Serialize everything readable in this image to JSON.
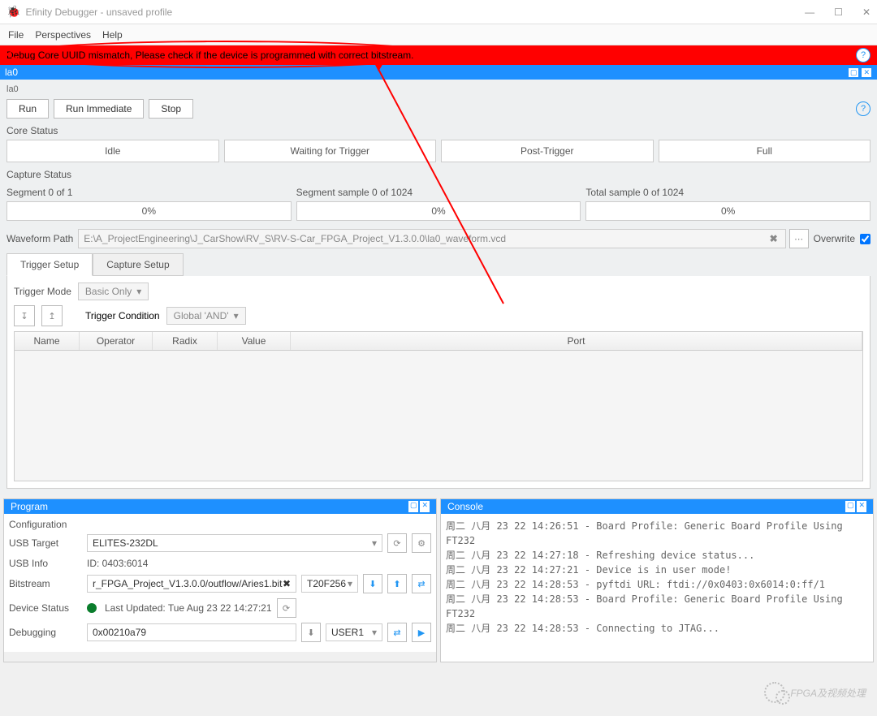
{
  "window": {
    "title": "Efinity Debugger - unsaved profile"
  },
  "menu": {
    "file": "File",
    "perspectives": "Perspectives",
    "help": "Help"
  },
  "error": {
    "message": "Debug Core UUID mismatch, Please check if the device is programmed with correct bitstream."
  },
  "la0": {
    "name": "la0",
    "label": "la0",
    "buttons": {
      "run": "Run",
      "run_immediate": "Run Immediate",
      "stop": "Stop"
    },
    "core_status": {
      "title": "Core Status",
      "idle": "Idle",
      "waiting": "Waiting for Trigger",
      "post": "Post-Trigger",
      "full": "Full"
    },
    "capture_status": {
      "title": "Capture Status",
      "segment": "Segment 0 of 1",
      "segment_sample": "Segment sample 0 of 1024",
      "total_sample": "Total sample 0 of 1024",
      "p1": "0%",
      "p2": "0%",
      "p3": "0%"
    },
    "waveform": {
      "label": "Waveform Path",
      "path": "E:\\A_ProjectEngineering\\J_CarShow\\RV_S\\RV-S-Car_FPGA_Project_V1.3.0.0\\la0_waveform.vcd",
      "overwrite": "Overwrite"
    },
    "tabs": {
      "trigger": "Trigger Setup",
      "capture": "Capture Setup"
    },
    "trigger": {
      "mode_label": "Trigger Mode",
      "mode_value": "Basic Only",
      "cond_label": "Trigger Condition",
      "cond_value": "Global 'AND'",
      "cols": {
        "name": "Name",
        "operator": "Operator",
        "radix": "Radix",
        "value": "Value",
        "port": "Port"
      }
    }
  },
  "program": {
    "title": "Program",
    "config": "Configuration",
    "usb_target_label": "USB Target",
    "usb_target_value": "ELITES-232DL",
    "usb_info_label": "USB Info",
    "usb_info_value": "ID: 0403:6014",
    "bitstream_label": "Bitstream",
    "bitstream_value": "r_FPGA_Project_V1.3.0.0/outflow/Aries1.bit",
    "device_value": "T20F256",
    "device_status_label": "Device Status",
    "device_status_value": "Last Updated: Tue Aug 23 22 14:27:21",
    "debugging_label": "Debugging",
    "debugging_value": "0x00210a79",
    "user_value": "USER1"
  },
  "console": {
    "title": "Console",
    "text": "周二 八月 23 22 14:26:51 - Board Profile: Generic Board Profile Using FT232\n周二 八月 23 22 14:27:18 - Refreshing device status...\n周二 八月 23 22 14:27:21 - Device is in user mode!\n周二 八月 23 22 14:28:53 - pyftdi URL: ftdi://0x0403:0x6014:0:ff/1\n周二 八月 23 22 14:28:53 - Board Profile: Generic Board Profile Using FT232\n周二 八月 23 22 14:28:53 - Connecting to JTAG..."
  },
  "watermark": "FPGA及视频处理"
}
